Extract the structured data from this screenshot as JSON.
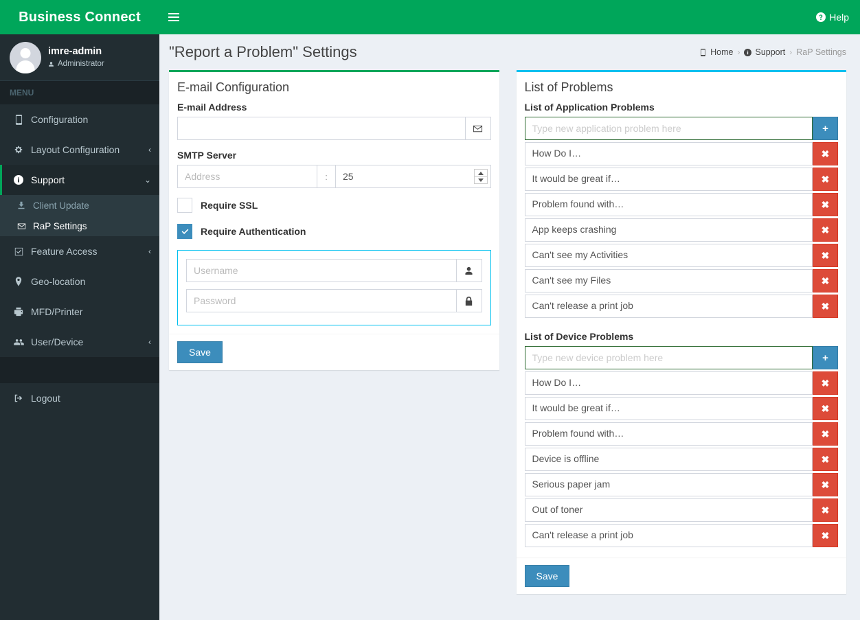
{
  "brand": {
    "title": "Business Connect"
  },
  "user": {
    "name": "imre-admin",
    "role": "Administrator"
  },
  "sidebar": {
    "menu_header": "MENU",
    "items": [
      {
        "label": "Configuration",
        "icon": "tablet-icon",
        "arrow": ""
      },
      {
        "label": "Layout Configuration",
        "icon": "gear-icon",
        "arrow": "‹"
      },
      {
        "label": "Support",
        "icon": "info-circle-icon",
        "arrow": "⌄"
      },
      {
        "label": "Feature Access",
        "icon": "check-square-icon",
        "arrow": "‹"
      },
      {
        "label": "Geo-location",
        "icon": "map-marker-icon",
        "arrow": ""
      },
      {
        "label": "MFD/Printer",
        "icon": "printer-icon",
        "arrow": ""
      },
      {
        "label": "User/Device",
        "icon": "users-icon",
        "arrow": "‹"
      }
    ],
    "support_submenu": [
      {
        "label": "Client Update",
        "icon": "download-icon"
      },
      {
        "label": "RaP Settings",
        "icon": "envelope-icon"
      }
    ],
    "logout": {
      "label": "Logout",
      "icon": "sign-out-icon"
    }
  },
  "topbar": {
    "hamburger": "menu-icon",
    "help_label": "Help",
    "help_icon": "question-circle-icon"
  },
  "header": {
    "page_title": "\"Report a Problem\" Settings",
    "breadcrumb": [
      {
        "label": "Home",
        "icon": "tablet-icon"
      },
      {
        "label": "Support",
        "icon": "info-circle-icon"
      },
      {
        "label": "RaP Settings",
        "icon": ""
      }
    ],
    "separator": "›"
  },
  "email_box": {
    "title": "E-mail Configuration",
    "email_label": "E-mail Address",
    "email_value": "",
    "email_placeholder": "",
    "email_icon": "envelope-icon",
    "smtp_label": "SMTP Server",
    "smtp_address_value": "",
    "smtp_address_placeholder": "Address",
    "colon": ":",
    "port_value": "25",
    "ssl_label": "Require SSL",
    "ssl_checked": false,
    "auth_label": "Require Authentication",
    "auth_checked": true,
    "username_value": "",
    "username_placeholder": "Username",
    "username_icon": "user-icon",
    "password_value": "",
    "password_placeholder": "Password",
    "password_icon": "lock-icon",
    "save_label": "Save"
  },
  "problems_box": {
    "title": "List of Problems",
    "app_section_label": "List of Application Problems",
    "app_input_value": "",
    "app_input_placeholder": "Type new application problem here",
    "app_items": [
      "How Do I…",
      "It would be great if…",
      "Problem found with…",
      "App keeps crashing",
      "Can't see my Activities",
      "Can't see my Files",
      "Can't release a print job"
    ],
    "device_section_label": "List of Device Problems",
    "device_input_value": "",
    "device_input_placeholder": "Type new device problem here",
    "device_items": [
      "How Do I…",
      "It would be great if…",
      "Problem found with…",
      "Device is offline",
      "Serious paper jam",
      "Out of toner",
      "Can't release a print job"
    ],
    "add_label": "+",
    "delete_label": "✖",
    "save_label": "Save"
  },
  "colors": {
    "brand_green": "#00a65a",
    "accent_blue": "#3c8dbc",
    "info_blue": "#00c0ef",
    "danger_red": "#dd4b39",
    "sidebar_dark": "#222d32",
    "page_bg": "#ecf0f5"
  }
}
